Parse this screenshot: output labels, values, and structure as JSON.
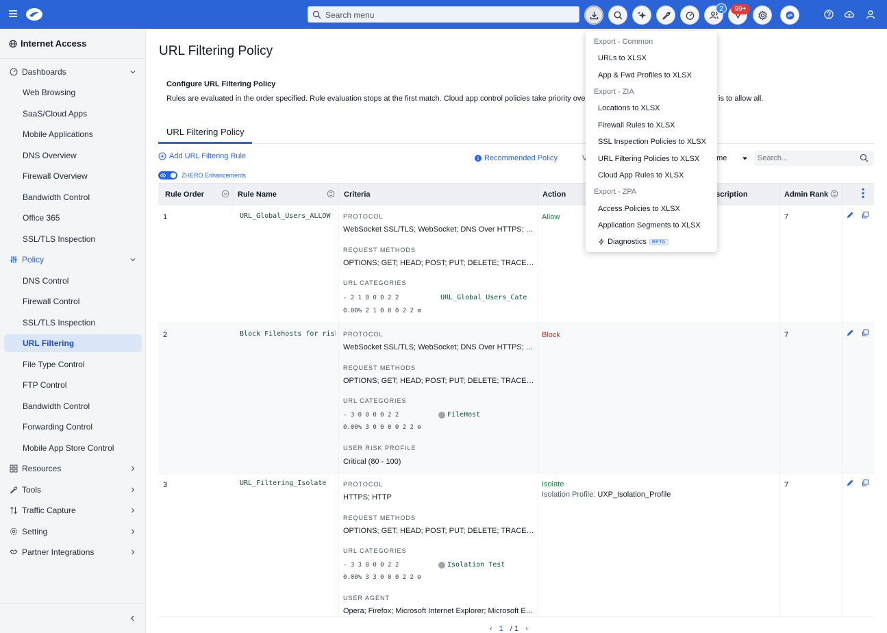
{
  "topbar": {
    "search_placeholder": "Search menu",
    "notifications_badge": "2",
    "alerts_badge": "99+"
  },
  "sidebar": {
    "title": "Internet Access",
    "dashboards": {
      "label": "Dashboards",
      "items": [
        "Web Browsing",
        "SaaS/Cloud Apps",
        "Mobile Applications",
        "DNS Overview",
        "Firewall Overview",
        "Bandwidth Control",
        "Office 365",
        "SSL/TLS Inspection"
      ]
    },
    "policy": {
      "label": "Policy",
      "items": [
        "DNS Control",
        "Firewall Control",
        "SSL/TLS Inspection",
        "URL Filtering",
        "File Type Control",
        "FTP Control",
        "Bandwidth Control",
        "Forwarding Control",
        "Mobile App Store Control"
      ]
    },
    "groups": [
      "Resources",
      "Tools",
      "Traffic Capture",
      "Setting",
      "Partner Integrations"
    ]
  },
  "main": {
    "title": "URL Filtering Policy",
    "config_title": "Configure URL Filtering Policy",
    "config_desc": "Rules are evaluated in the order specified. Rule evaluation stops at the first match. Cloud app control policies take priority over URL",
    "config_desc_tail": "is to allow all.",
    "tab": "URL Filtering Policy",
    "add_rule": "Add URL Filtering Rule",
    "recommended": "Recommended Policy",
    "view_fragment": "V",
    "name_select": "ame",
    "search_placeholder": "Search...",
    "zhero": "ZHERO Enhancements"
  },
  "table": {
    "headers": {
      "rule_order": "Rule Order",
      "rule_name": "Rule Name",
      "criteria": "Criteria",
      "action": "Action",
      "description": "escription",
      "admin_rank": "Admin Rank"
    },
    "labels": {
      "protocol": "PROTOCOL",
      "request_methods": "REQUEST METHODS",
      "url_categories": "URL CATEGORIES",
      "user_risk_profile": "USER RISK PROFILE",
      "user_agent": "USER AGENT",
      "isolation_profile": "Isolation Profile:"
    },
    "rows": [
      {
        "order": "1",
        "name": "URL_Global_Users_ALLOW",
        "protocol": "WebSocket SSL/TLS; WebSocket; DNS Over HTTPS; Tun...",
        "methods": "OPTIONS; GET; HEAD; POST; PUT; DELETE; TRACE; CON...",
        "cat_line1": "-  2  1  0  0  0  2  2",
        "cat_line2": "0.00%  2  1  0  0  0  2  2  ⚙",
        "category": "URL_Global_Users_Categ",
        "action": "Allow",
        "rank": "7"
      },
      {
        "order": "2",
        "name": "Block Filehosts for risky u",
        "protocol": "WebSocket SSL/TLS; WebSocket; DNS Over HTTPS; Tun...",
        "methods": "OPTIONS; GET; HEAD; POST; PUT; DELETE; TRACE; CON...",
        "cat_line1": "-  3  0  0  0  0  2  2",
        "cat_line2": "0.00%  3  0  0  0  0  2  2  ⚙",
        "category": "FileHost",
        "risk": "Critical (80 - 100)",
        "action": "Block",
        "rank": "7"
      },
      {
        "order": "3",
        "name": "URL_Filtering_Isolate",
        "protocol": "HTTPS; HTTP",
        "methods": "OPTIONS; GET; HEAD; POST; PUT; DELETE; TRACE; CON...",
        "cat_line1": "-  3  3  0  0  0  2  2",
        "cat_line2": "0.00%  3  3  0  0  0  2  2  ⚙",
        "category": "Isolation Test",
        "user_agent": "Opera; Firefox; Microsoft Internet Explorer; Microsoft Edg...",
        "action": "Isolate",
        "isolation_profile": "UXP_Isolation_Profile",
        "rank": "7"
      }
    ]
  },
  "pager": {
    "current": "1",
    "total": "/ 1"
  },
  "export_menu": {
    "common_header": "Export - Common",
    "common": [
      "URLs to XLSX",
      "App & Fwd Profiles to XLSX"
    ],
    "zia_header": "Export - ZIA",
    "zia": [
      "Locations to XLSX",
      "Firewall Rules to XLSX",
      "SSL Inspection Policies to XLSX",
      "URL Filtering Policies to XLSX",
      "Cloud App Rules to XLSX"
    ],
    "zpa_header": "Export - ZPA",
    "zpa": [
      "Access Policies to XLSX",
      "Application Segments to XLSX"
    ],
    "diagnostics": "Diagnostics",
    "beta": "BETA"
  }
}
